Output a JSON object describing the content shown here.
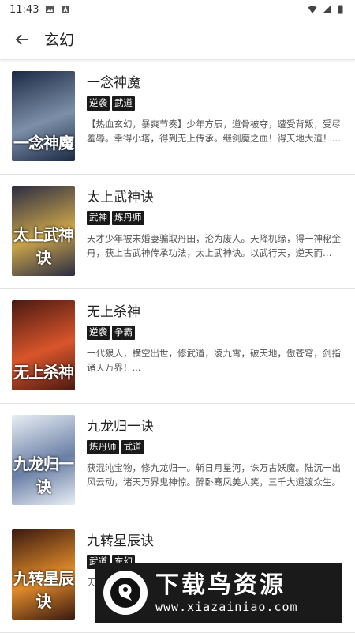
{
  "status_bar": {
    "time": "11:43",
    "icons": [
      "image-icon",
      "a-icon",
      "wifi-icon",
      "signal-icon",
      "battery-icon"
    ]
  },
  "app_bar": {
    "title": "玄幻",
    "back_icon": "arrow-left-icon"
  },
  "books": [
    {
      "title": "一念神魔",
      "tags": [
        "逆袭",
        "武道"
      ],
      "description": "【热血玄幻，暴爽节奏】少年方辰，道骨被夺，遭受背叛，受尽羞辱。幸得小塔，得到无上传承。继剑魔之血！得天地大道！一...",
      "cover_text": "一念神魔",
      "cover_colors": [
        "#1b2a44",
        "#7d8fa8"
      ]
    },
    {
      "title": "太上武神诀",
      "tags": [
        "武神",
        "炼丹师"
      ],
      "description": "天才少年被未婚妻骗取丹田，沦为废人。天降机缘，得一神秘金丹，获上古武神传承功法，太上武神诀。以武行天，逆天而行！...",
      "cover_text": "太上武神诀",
      "cover_colors": [
        "#2a2c44",
        "#c7a24a"
      ]
    },
    {
      "title": "无上杀神",
      "tags": [
        "逆袭",
        "争霸"
      ],
      "description": "一代狠人，横空出世，修武道，凌九霄，破天地，傲苍穹，剑指诸天万界！...",
      "cover_text": "无上杀神",
      "cover_colors": [
        "#4a1a12",
        "#d9552b"
      ]
    },
    {
      "title": "九龙归一诀",
      "tags": [
        "炼丹师",
        "武道"
      ],
      "description": "获混沌宝物，修九龙归一。斩日月星河，诛万古妖魔。陆沉一出风云动，诸天万界鬼神惊。醉卧骞凤美人笑，三千大道渡众生。",
      "cover_text": "九龙归一诀",
      "cover_colors": [
        "#e8eef4",
        "#6a7fa6"
      ]
    },
    {
      "title": "九转星辰诀",
      "tags": [
        "武道",
        "东幻"
      ],
      "description": "天...",
      "cover_text": "九转星辰诀",
      "cover_colors": [
        "#3a1a10",
        "#e08a2a"
      ]
    }
  ],
  "watermark": {
    "title": "下载鸟资源",
    "url": "www.xiazainiao.com"
  }
}
